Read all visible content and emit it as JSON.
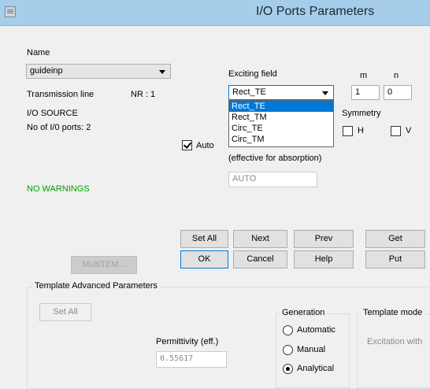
{
  "window": {
    "title": "I/O Ports Parameters"
  },
  "left": {
    "name_label": "Name",
    "name_value": "guideinp",
    "transmission_line": "Transmission line",
    "nr": "NR : 1",
    "io_source": "I/O SOURCE",
    "num_ports": "No of I/0 ports: 2",
    "warnings": "NO WARNINGS",
    "multitem": "MultiTEM..."
  },
  "exciting": {
    "label": "Exciting field",
    "value": "Rect_TE",
    "options": [
      "Rect_TE",
      "Rect_TM",
      "Circ_TE",
      "Circ_TM"
    ],
    "m_label": "m",
    "n_label": "n",
    "m_value": "1",
    "n_value": "0"
  },
  "symmetry": {
    "label": "Symmetry",
    "h": "H",
    "v": "V"
  },
  "auto": {
    "label": "Auto",
    "effective": "(effective for absorption)",
    "field_value": "AUTO"
  },
  "buttons": {
    "set_all": "Set All",
    "next": "Next",
    "prev": "Prev",
    "get": "Get",
    "ok": "OK",
    "cancel": "Cancel",
    "help": "Help",
    "put": "Put"
  },
  "template": {
    "title": "Template Advanced Parameters",
    "set_all": "Set All",
    "permittivity_label": "Permittivity (eff.)",
    "permittivity_value": "0.55617",
    "generation": {
      "title": "Generation",
      "options": [
        "Automatic",
        "Manual",
        "Analytical"
      ],
      "selected": "Analytical"
    },
    "mode": {
      "title": "Template mode",
      "excitation": "Excitation with"
    }
  },
  "colors": {
    "titlebar": "#a6cdea",
    "accent": "#0078d7",
    "warning_ok": "#00a000"
  }
}
